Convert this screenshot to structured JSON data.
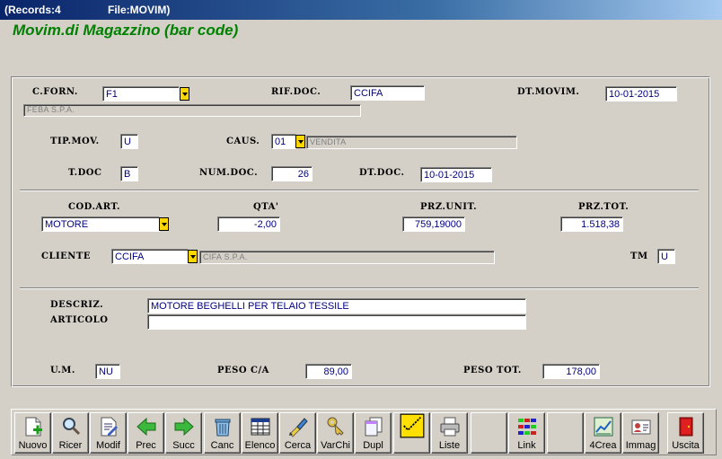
{
  "window": {
    "records": "(Records:4",
    "file": "File:MOVIM)"
  },
  "app_title": "Movim.di Magazzino (bar code)",
  "form": {
    "cforn": {
      "label": "C.FORN.",
      "value": "F1",
      "desc": "FEBA S.P.A."
    },
    "rifdoc": {
      "label": "RIF.DOC.",
      "value": "CCIFA"
    },
    "dtmovim": {
      "label": "DT.MOVIM.",
      "value": "10-01-2015"
    },
    "tipmov": {
      "label": "TIP.MOV.",
      "value": "U"
    },
    "caus": {
      "label": "CAUS.",
      "value": "01",
      "desc": "VENDITA"
    },
    "tdoc": {
      "label": "T.DOC",
      "value": "B"
    },
    "numdoc": {
      "label": "NUM.DOC.",
      "value": "26"
    },
    "dtdoc": {
      "label": "DT.DOC.",
      "value": "10-01-2015"
    },
    "codart": {
      "label": "COD.ART.",
      "value": "MOTORE"
    },
    "qta": {
      "label": "QTA'",
      "value": "-2,00"
    },
    "przunit": {
      "label": "PRZ.UNIT.",
      "value": "759,19000"
    },
    "przto": {
      "label": "PRZ.TOT.",
      "value": "1.518,38"
    },
    "cliente": {
      "label": "CLIENTE",
      "value": "CCIFA",
      "desc": "CIFA S.P.A."
    },
    "tm": {
      "label": "TM",
      "value": "U"
    },
    "descriz": {
      "label1": "DESCRIZ.",
      "label2": "ARTICOLO",
      "value1": "MOTORE BEGHELLI PER TELAIO TESSILE",
      "value2": ""
    },
    "um": {
      "label": "U.M.",
      "value": "NU"
    },
    "pesoca": {
      "label": "PESO C/A",
      "value": "89,00"
    },
    "pesotot": {
      "label": "PESO TOT.",
      "value": "178,00"
    }
  },
  "toolbar": [
    {
      "label": "Nuovo",
      "icon": "new-document-icon"
    },
    {
      "label": "Ricer",
      "icon": "magnifier-icon"
    },
    {
      "label": "Modif",
      "icon": "edit-document-icon"
    },
    {
      "label": "Prec",
      "icon": "arrow-left-icon"
    },
    {
      "label": "Succ",
      "icon": "arrow-right-icon"
    },
    {
      "label": "Canc",
      "icon": "trash-icon"
    },
    {
      "label": "Elenco",
      "icon": "table-icon"
    },
    {
      "label": "Cerca",
      "icon": "search-brush-icon"
    },
    {
      "label": "VarChi",
      "icon": "keys-icon"
    },
    {
      "label": "Dupl",
      "icon": "copy-icon"
    },
    {
      "label": "",
      "icon": "checklist-icon"
    },
    {
      "label": "Liste",
      "icon": "printer-icon"
    },
    {
      "label": "",
      "icon": ""
    },
    {
      "label": "Link",
      "icon": "grid-link-icon"
    },
    {
      "label": "",
      "icon": ""
    },
    {
      "label": "4Crea",
      "icon": "chart-create-icon"
    },
    {
      "label": "Immag",
      "icon": "id-card-icon"
    },
    {
      "label": "Uscita",
      "icon": "exit-door-icon"
    }
  ]
}
